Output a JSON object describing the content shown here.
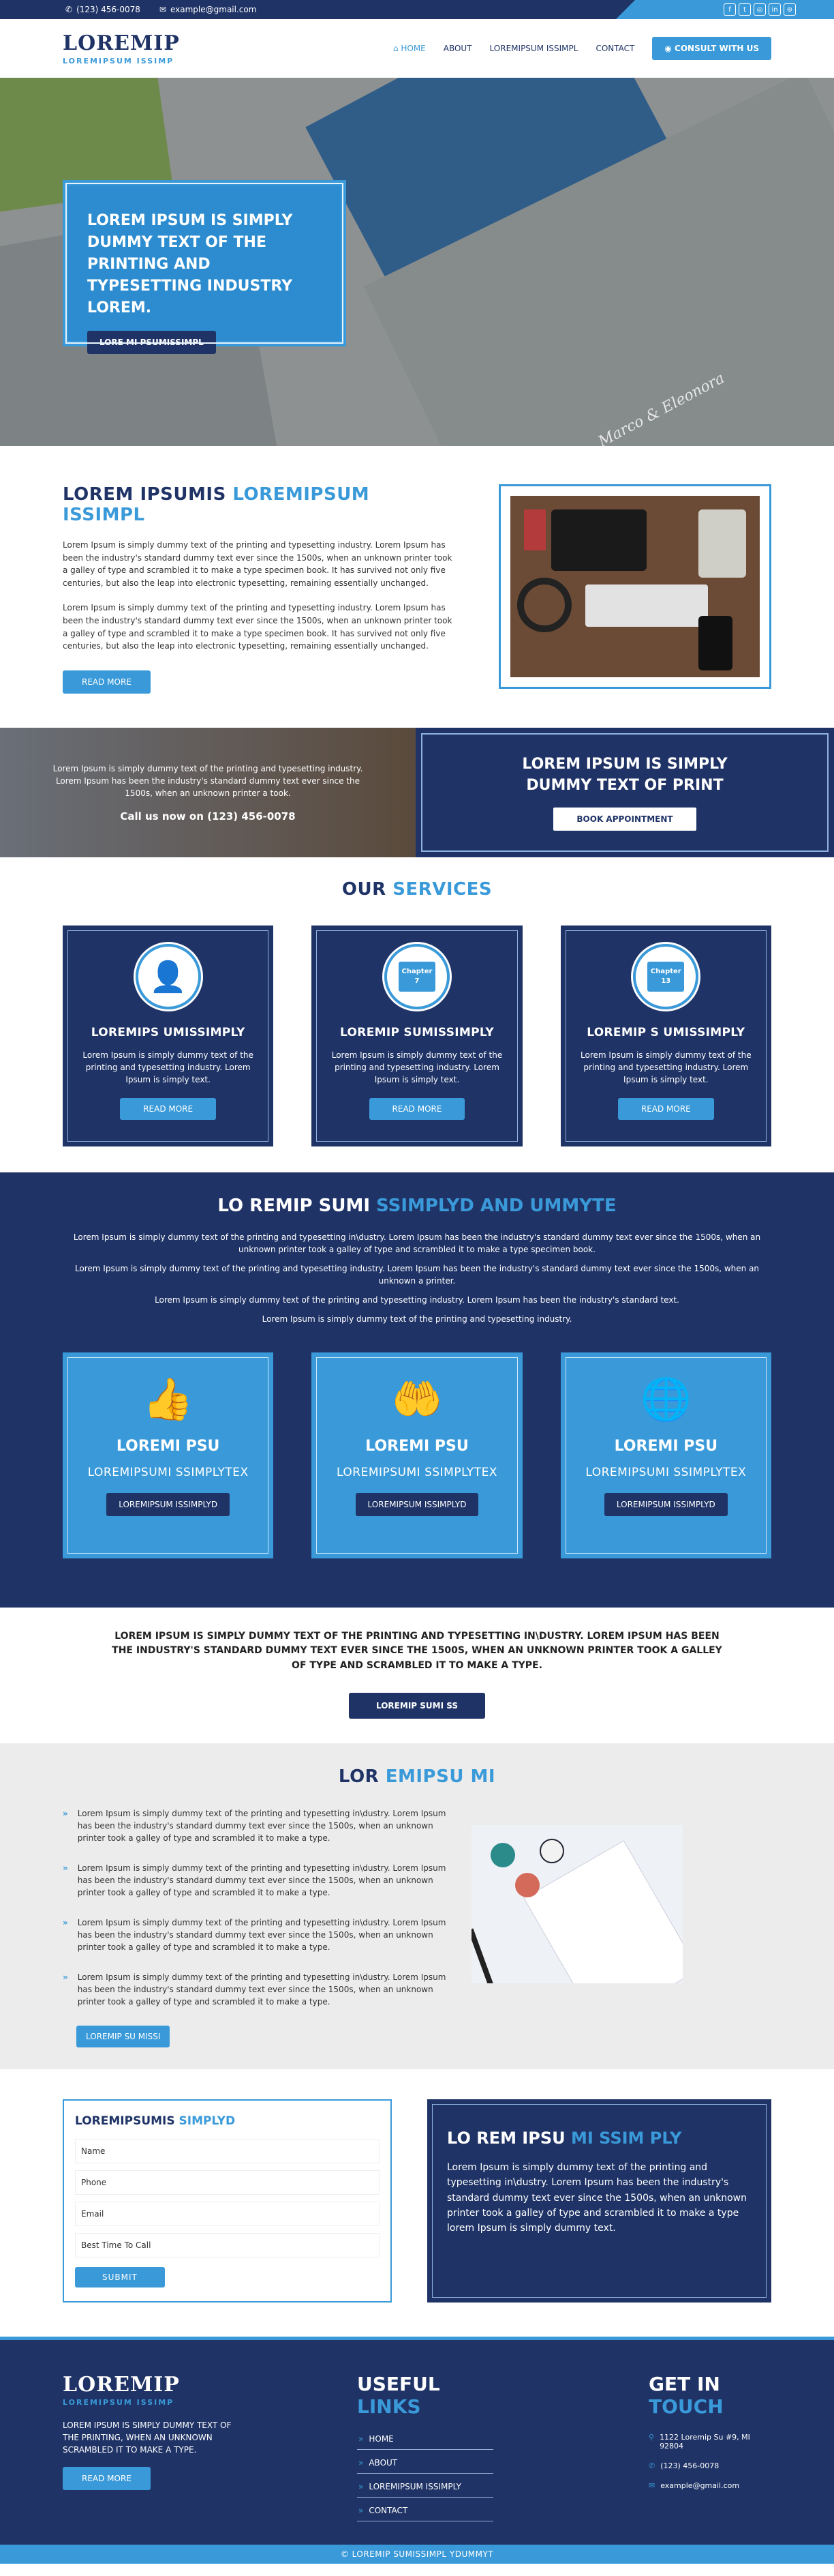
{
  "topbar": {
    "phone": "(123) 456-0078",
    "email": "example@gmail.com",
    "social": [
      "f",
      "t",
      "◎",
      "in",
      "⊛"
    ]
  },
  "header": {
    "logo": "LOREMIP",
    "tagline": "LOREMIPSUM ISSIMP"
  },
  "nav": {
    "home": "HOME",
    "about": "ABOUT",
    "services": "LOREMIPSUM ISSIMPL",
    "contact": "CONTACT",
    "consult": "CONSULT WITH US"
  },
  "hero": {
    "title": "LOREM IPSUM IS SIMPLY DUMMY TEXT OF THE PRINTING AND TYPESETTING INDUSTRY LOREM.",
    "button": "LORE MI PSUMISSIMPL",
    "signature": "Marco & Eleonora"
  },
  "about": {
    "title_a": "LOREM IPSUMIS ",
    "title_b": "LOREMIPSUM ISSIMPL",
    "p1": "Lorem Ipsum is simply dummy text of the printing and typesetting industry. Lorem Ipsum has been the industry's standard dummy text ever since the 1500s, when an unknown printer took a galley of type and scrambled it to make a type specimen book. It has survived not only five centuries, but also the leap into electronic typesetting, remaining essentially unchanged.",
    "p2": "Lorem Ipsum is simply dummy text of the printing and typesetting industry. Lorem Ipsum has been the industry's standard dummy text ever since the 1500s, when an unknown printer took a galley of type and scrambled it to make a type specimen book. It has survived not only five centuries, but also the leap into electronic typesetting, remaining essentially unchanged.",
    "button": "READ MORE"
  },
  "cta": {
    "text": "Lorem Ipsum is simply dummy text of the printing and typesetting industry. Lorem Ipsum has been the industry's standard dummy text ever since the 1500s, when an unknown printer a took.",
    "call": "Call us now on (123) 456-0078",
    "title": "LOREM IPSUM IS SIMPLY DUMMY TEXT OF PRINT",
    "button": "BOOK APPOINTMENT"
  },
  "services": {
    "title_a": "OUR ",
    "title_b": "SERVICES",
    "items": [
      {
        "title": "LOREMIPS UMISSIMPLY",
        "text": "Lorem Ipsum is simply dummy text of the printing and typesetting industry. Lorem Ipsum is simply text.",
        "button": "READ MORE",
        "icon": "person-book-icon"
      },
      {
        "title": "LOREMIP SUMISSIMPLY",
        "text": "Lorem Ipsum is simply dummy text of the printing and typesetting industry. Lorem Ipsum is simply text.",
        "button": "READ MORE",
        "icon": "chapter-icon",
        "chapter": "Chapter",
        "num": "7"
      },
      {
        "title": "LOREMIP S UMISSIMPLY",
        "text": "Lorem Ipsum is simply dummy text of the printing and typesetting industry. Lorem Ipsum is simply text.",
        "button": "READ MORE",
        "icon": "chapter-icon",
        "chapter": "Chapter",
        "num": "13"
      }
    ]
  },
  "features": {
    "title_a": "LO REMIP SUMI ",
    "title_b": "SSIMPLYD AND UMMYTE",
    "p1": "Lorem Ipsum is simply dummy text of the printing and typesetting in\\dustry. Lorem Ipsum has been the industry's standard dummy text ever since the 1500s, when an unknown printer took a galley of type and scrambled it to make a type specimen book.",
    "p2": "Lorem Ipsum is simply dummy text of the printing and typesetting industry. Lorem Ipsum has been the industry's standard dummy text ever since the 1500s, when an unknown a printer.",
    "p3": "Lorem Ipsum is simply dummy text of the printing and typesetting industry. Lorem Ipsum has been the industry's standard text.",
    "p4": "Lorem Ipsum is simply dummy text of the printing and typesetting industry.",
    "items": [
      {
        "title": "LOREMI PSU",
        "sub": "LOREMIPSUMI SSIMPLYTEX",
        "button": "LOREMIPSUM ISSIMPLYD",
        "icon": "thumbs-up-icon"
      },
      {
        "title": "LOREMI PSU",
        "sub": "LOREMIPSUMI SSIMPLYTEX",
        "button": "LOREMIPSUM ISSIMPLYD",
        "icon": "hands-coin-icon"
      },
      {
        "title": "LOREMI PSU",
        "sub": "LOREMIPSUMI SSIMPLYTEX",
        "button": "LOREMIPSUM ISSIMPLYD",
        "icon": "globe-icon"
      }
    ]
  },
  "banner": {
    "text": "LOREM IPSUM IS SIMPLY DUMMY TEXT OF THE PRINTING AND TYPESETTING IN\\DUSTRY. LOREM IPSUM HAS BEEN THE INDUSTRY'S STANDARD DUMMY TEXT EVER SINCE THE 1500S, WHEN AN UNKNOWN PRINTER TOOK A GALLEY OF TYPE AND SCRAMBLED IT TO MAKE A TYPE.",
    "button": "LOREMIP SUMI SS"
  },
  "list": {
    "title_a": "LOR ",
    "title_b": "EMIPSU MI",
    "items": [
      "Lorem Ipsum is simply dummy text of the printing and typesetting in\\dustry. Lorem Ipsum has been the industry's standard dummy text ever since the 1500s, when an unknown printer took a galley of type and scrambled it to make a type.",
      "Lorem Ipsum is simply dummy text of the printing and typesetting in\\dustry. Lorem Ipsum has been the industry's standard dummy text ever since the 1500s, when an unknown printer took a galley of type and scrambled it to make a type.",
      "Lorem Ipsum is simply dummy text of the printing and typesetting in\\dustry. Lorem Ipsum has been the industry's standard dummy text ever since the 1500s, when an unknown printer took a galley of type and scrambled it to make a type.",
      "Lorem Ipsum is simply dummy text of the printing and typesetting in\\dustry. Lorem Ipsum has been the industry's standard dummy text ever since the 1500s, when an unknown printer took a galley of type and scrambled it to make a type."
    ],
    "button": "LOREMIP SU MISSI"
  },
  "form": {
    "title_a": "LOREMIPSUMIS ",
    "title_b": "SIMPLYD",
    "name": "Name",
    "phone": "Phone",
    "email": "Email",
    "time": "Best Time To Call",
    "submit": "SUBMIT"
  },
  "cbox": {
    "title_a": "LO REM IPSU ",
    "title_b": "MI SSIM PLY",
    "text": "Lorem Ipsum is simply dummy text of the printing and typesetting in\\dustry. Lorem Ipsum has been the industry's standard dummy text ever since the 1500s, when an unknown printer took a galley of type and scrambled it to make a type lorem Ipsum is simply dummy text."
  },
  "footer": {
    "logo": "LOREMIP",
    "tagline": "LOREMIPSUM ISSIMP",
    "text": "LOREM IPSUM IS SIMPLY DUMMY TEXT OF THE PRINTING, WHEN AN UNKNOWN SCRAMBLED IT TO MAKE A TYPE.",
    "button": "READ MORE",
    "links_a": "USEFUL ",
    "links_b": "LINKS",
    "links": [
      "HOME",
      "ABOUT",
      "LOREMIPSUM ISSIMPLY",
      "CONTACT"
    ],
    "touch_a": "GET IN ",
    "touch_b": "TOUCH",
    "address": "1122 Loremip Su #9, MI 92804",
    "phone": "(123) 456-0078",
    "email": "example@gmail.com",
    "copyright": "© LOREMIP SUMISSIMPL YDUMMYT"
  },
  "colors": {
    "navy": "#1f3366",
    "blue": "#3a9ad9"
  }
}
